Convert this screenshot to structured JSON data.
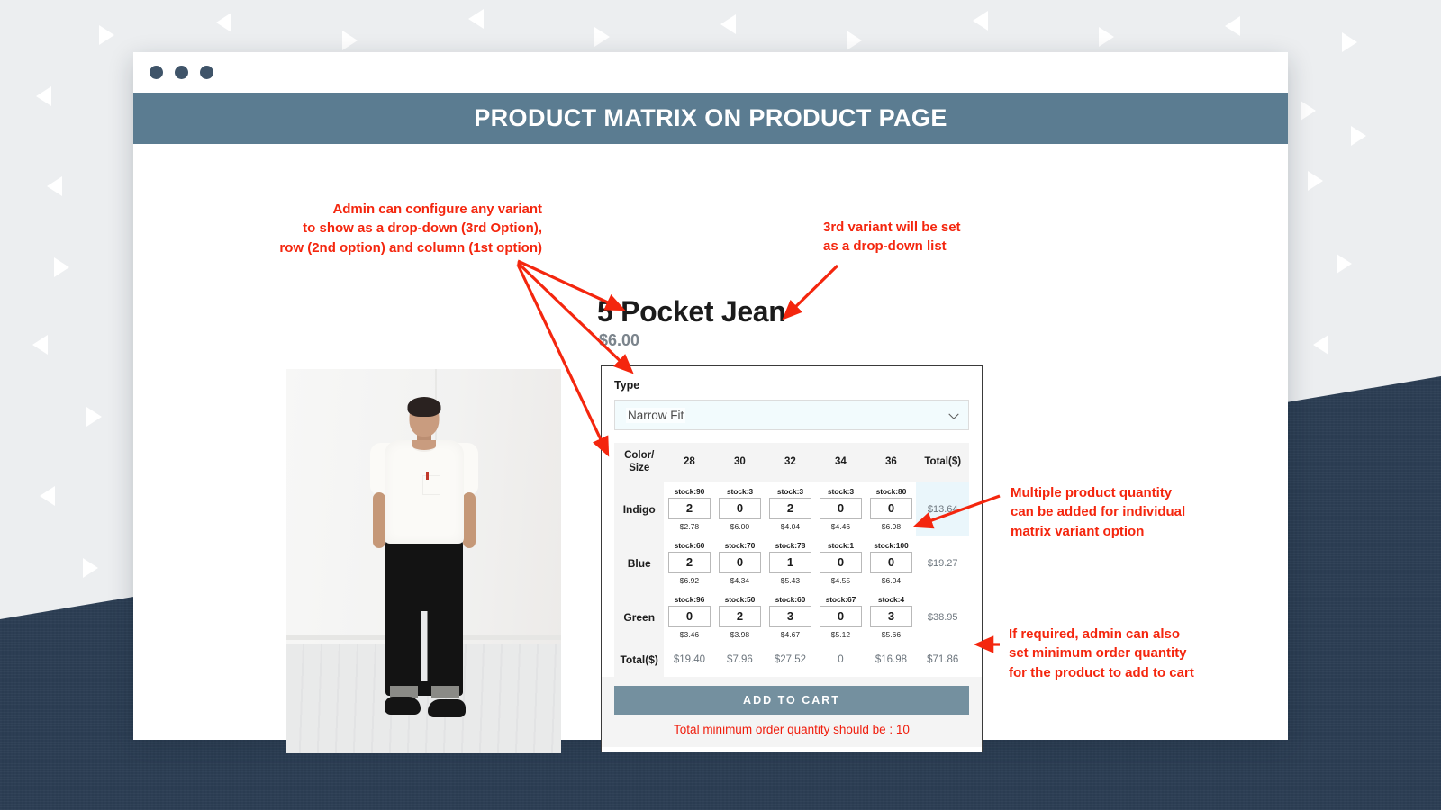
{
  "window": {
    "dots": [
      "dot-1",
      "dot-2",
      "dot-3"
    ],
    "banner_title": "PRODUCT MATRIX ON PRODUCT PAGE"
  },
  "product": {
    "title": "5 Pocket Jean",
    "price": "$6.00",
    "image_alt": "Male model wearing white t-shirt and black 5 pocket jeans in a white room"
  },
  "matrix": {
    "type_label": "Type",
    "selected_option": "Narrow Fit",
    "dropdown_icon": "chevron-down-icon",
    "corner_header_line1": "Color/",
    "corner_header_line2": "Size",
    "column_headers": [
      "28",
      "30",
      "32",
      "34",
      "36"
    ],
    "total_header": "Total($)",
    "rows": [
      {
        "label": "Indigo",
        "cells": [
          {
            "stock": "stock:90",
            "qty": "2",
            "price": "$2.78"
          },
          {
            "stock": "stock:3",
            "qty": "0",
            "price": "$6.00"
          },
          {
            "stock": "stock:3",
            "qty": "2",
            "price": "$4.04"
          },
          {
            "stock": "stock:3",
            "qty": "0",
            "price": "$4.46"
          },
          {
            "stock": "stock:80",
            "qty": "0",
            "price": "$6.98"
          }
        ],
        "row_total": "$13.64"
      },
      {
        "label": "Blue",
        "cells": [
          {
            "stock": "stock:60",
            "qty": "2",
            "price": "$6.92"
          },
          {
            "stock": "stock:70",
            "qty": "0",
            "price": "$4.34"
          },
          {
            "stock": "stock:78",
            "qty": "1",
            "price": "$5.43"
          },
          {
            "stock": "stock:1",
            "qty": "0",
            "price": "$4.55"
          },
          {
            "stock": "stock:100",
            "qty": "0",
            "price": "$6.04"
          }
        ],
        "row_total": "$19.27"
      },
      {
        "label": "Green",
        "cells": [
          {
            "stock": "stock:96",
            "qty": "0",
            "price": "$3.46"
          },
          {
            "stock": "stock:50",
            "qty": "2",
            "price": "$3.98"
          },
          {
            "stock": "stock:60",
            "qty": "3",
            "price": "$4.67"
          },
          {
            "stock": "stock:67",
            "qty": "0",
            "price": "$5.12"
          },
          {
            "stock": "stock:4",
            "qty": "3",
            "price": "$5.66"
          }
        ],
        "row_total": "$38.95"
      }
    ],
    "totals_row": {
      "label": "Total($)",
      "values": [
        "$19.40",
        "$7.96",
        "$27.52",
        "0",
        "$16.98"
      ],
      "grand_total": "$71.86"
    },
    "add_to_cart_label": "ADD TO CART",
    "min_order_message": "Total minimum order quantity should be : 10"
  },
  "annotations": {
    "a1": "Admin can configure any variant to show as a drop-down (3rd Option), row (2nd option) and column (1st option)",
    "a1_lines": [
      "Admin can configure any variant",
      "to show as a drop-down (3rd Option),",
      "row (2nd option) and column (1st option)"
    ],
    "a2_lines": [
      "3rd variant will be set",
      "as a drop-down list"
    ],
    "a3_lines": [
      "Multiple product quantity",
      "can be added for individual",
      "matrix variant option"
    ],
    "a4_lines": [
      "If required, admin can also",
      "set minimum order quantity",
      "for the product to add to cart"
    ]
  },
  "colors": {
    "banner_blue": "#5b7c91",
    "annotation_red": "#f4260e",
    "button_blue": "#74909f",
    "navy_bg": "#2c3e54",
    "light_bg": "#eceef0"
  }
}
